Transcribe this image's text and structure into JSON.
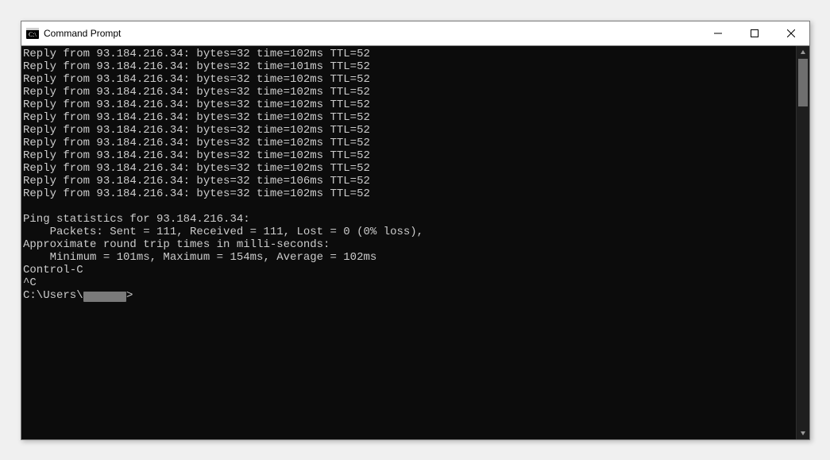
{
  "window": {
    "title": "Command Prompt"
  },
  "terminal": {
    "ip": "93.184.216.34",
    "replies": [
      {
        "bytes": 32,
        "time_ms": 102,
        "ttl": 52
      },
      {
        "bytes": 32,
        "time_ms": 101,
        "ttl": 52
      },
      {
        "bytes": 32,
        "time_ms": 102,
        "ttl": 52
      },
      {
        "bytes": 32,
        "time_ms": 102,
        "ttl": 52
      },
      {
        "bytes": 32,
        "time_ms": 102,
        "ttl": 52
      },
      {
        "bytes": 32,
        "time_ms": 102,
        "ttl": 52
      },
      {
        "bytes": 32,
        "time_ms": 102,
        "ttl": 52
      },
      {
        "bytes": 32,
        "time_ms": 102,
        "ttl": 52
      },
      {
        "bytes": 32,
        "time_ms": 102,
        "ttl": 52
      },
      {
        "bytes": 32,
        "time_ms": 102,
        "ttl": 52
      },
      {
        "bytes": 32,
        "time_ms": 106,
        "ttl": 52
      },
      {
        "bytes": 32,
        "time_ms": 102,
        "ttl": 52
      }
    ],
    "stats_header": "Ping statistics for 93.184.216.34:",
    "packets_line": "    Packets: Sent = 111, Received = 111, Lost = 0 (0% loss),",
    "rtt_header": "Approximate round trip times in milli-seconds:",
    "rtt_line": "    Minimum = 101ms, Maximum = 154ms, Average = 102ms",
    "control_c": "Control-C",
    "caret_c": "^C",
    "prompt_prefix": "C:\\Users\\",
    "prompt_user_redacted": "      ",
    "prompt_suffix": ">"
  }
}
